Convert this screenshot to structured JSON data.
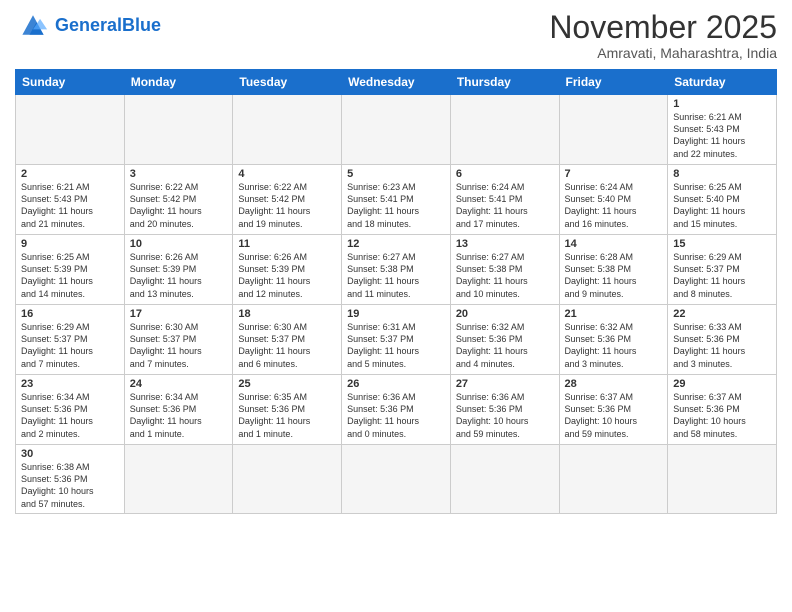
{
  "logo": {
    "general": "General",
    "blue": "Blue"
  },
  "header": {
    "month": "November 2025",
    "location": "Amravati, Maharashtra, India"
  },
  "weekdays": [
    "Sunday",
    "Monday",
    "Tuesday",
    "Wednesday",
    "Thursday",
    "Friday",
    "Saturday"
  ],
  "weeks": [
    [
      {
        "day": "",
        "info": ""
      },
      {
        "day": "",
        "info": ""
      },
      {
        "day": "",
        "info": ""
      },
      {
        "day": "",
        "info": ""
      },
      {
        "day": "",
        "info": ""
      },
      {
        "day": "",
        "info": ""
      },
      {
        "day": "1",
        "info": "Sunrise: 6:21 AM\nSunset: 5:43 PM\nDaylight: 11 hours\nand 22 minutes."
      }
    ],
    [
      {
        "day": "2",
        "info": "Sunrise: 6:21 AM\nSunset: 5:43 PM\nDaylight: 11 hours\nand 21 minutes."
      },
      {
        "day": "3",
        "info": "Sunrise: 6:22 AM\nSunset: 5:42 PM\nDaylight: 11 hours\nand 20 minutes."
      },
      {
        "day": "4",
        "info": "Sunrise: 6:22 AM\nSunset: 5:42 PM\nDaylight: 11 hours\nand 19 minutes."
      },
      {
        "day": "5",
        "info": "Sunrise: 6:23 AM\nSunset: 5:41 PM\nDaylight: 11 hours\nand 18 minutes."
      },
      {
        "day": "6",
        "info": "Sunrise: 6:24 AM\nSunset: 5:41 PM\nDaylight: 11 hours\nand 17 minutes."
      },
      {
        "day": "7",
        "info": "Sunrise: 6:24 AM\nSunset: 5:40 PM\nDaylight: 11 hours\nand 16 minutes."
      },
      {
        "day": "8",
        "info": "Sunrise: 6:25 AM\nSunset: 5:40 PM\nDaylight: 11 hours\nand 15 minutes."
      }
    ],
    [
      {
        "day": "9",
        "info": "Sunrise: 6:25 AM\nSunset: 5:39 PM\nDaylight: 11 hours\nand 14 minutes."
      },
      {
        "day": "10",
        "info": "Sunrise: 6:26 AM\nSunset: 5:39 PM\nDaylight: 11 hours\nand 13 minutes."
      },
      {
        "day": "11",
        "info": "Sunrise: 6:26 AM\nSunset: 5:39 PM\nDaylight: 11 hours\nand 12 minutes."
      },
      {
        "day": "12",
        "info": "Sunrise: 6:27 AM\nSunset: 5:38 PM\nDaylight: 11 hours\nand 11 minutes."
      },
      {
        "day": "13",
        "info": "Sunrise: 6:27 AM\nSunset: 5:38 PM\nDaylight: 11 hours\nand 10 minutes."
      },
      {
        "day": "14",
        "info": "Sunrise: 6:28 AM\nSunset: 5:38 PM\nDaylight: 11 hours\nand 9 minutes."
      },
      {
        "day": "15",
        "info": "Sunrise: 6:29 AM\nSunset: 5:37 PM\nDaylight: 11 hours\nand 8 minutes."
      }
    ],
    [
      {
        "day": "16",
        "info": "Sunrise: 6:29 AM\nSunset: 5:37 PM\nDaylight: 11 hours\nand 7 minutes."
      },
      {
        "day": "17",
        "info": "Sunrise: 6:30 AM\nSunset: 5:37 PM\nDaylight: 11 hours\nand 7 minutes."
      },
      {
        "day": "18",
        "info": "Sunrise: 6:30 AM\nSunset: 5:37 PM\nDaylight: 11 hours\nand 6 minutes."
      },
      {
        "day": "19",
        "info": "Sunrise: 6:31 AM\nSunset: 5:37 PM\nDaylight: 11 hours\nand 5 minutes."
      },
      {
        "day": "20",
        "info": "Sunrise: 6:32 AM\nSunset: 5:36 PM\nDaylight: 11 hours\nand 4 minutes."
      },
      {
        "day": "21",
        "info": "Sunrise: 6:32 AM\nSunset: 5:36 PM\nDaylight: 11 hours\nand 3 minutes."
      },
      {
        "day": "22",
        "info": "Sunrise: 6:33 AM\nSunset: 5:36 PM\nDaylight: 11 hours\nand 3 minutes."
      }
    ],
    [
      {
        "day": "23",
        "info": "Sunrise: 6:34 AM\nSunset: 5:36 PM\nDaylight: 11 hours\nand 2 minutes."
      },
      {
        "day": "24",
        "info": "Sunrise: 6:34 AM\nSunset: 5:36 PM\nDaylight: 11 hours\nand 1 minute."
      },
      {
        "day": "25",
        "info": "Sunrise: 6:35 AM\nSunset: 5:36 PM\nDaylight: 11 hours\nand 1 minute."
      },
      {
        "day": "26",
        "info": "Sunrise: 6:36 AM\nSunset: 5:36 PM\nDaylight: 11 hours\nand 0 minutes."
      },
      {
        "day": "27",
        "info": "Sunrise: 6:36 AM\nSunset: 5:36 PM\nDaylight: 10 hours\nand 59 minutes."
      },
      {
        "day": "28",
        "info": "Sunrise: 6:37 AM\nSunset: 5:36 PM\nDaylight: 10 hours\nand 59 minutes."
      },
      {
        "day": "29",
        "info": "Sunrise: 6:37 AM\nSunset: 5:36 PM\nDaylight: 10 hours\nand 58 minutes."
      }
    ],
    [
      {
        "day": "30",
        "info": "Sunrise: 6:38 AM\nSunset: 5:36 PM\nDaylight: 10 hours\nand 57 minutes."
      },
      {
        "day": "",
        "info": ""
      },
      {
        "day": "",
        "info": ""
      },
      {
        "day": "",
        "info": ""
      },
      {
        "day": "",
        "info": ""
      },
      {
        "day": "",
        "info": ""
      },
      {
        "day": "",
        "info": ""
      }
    ]
  ]
}
